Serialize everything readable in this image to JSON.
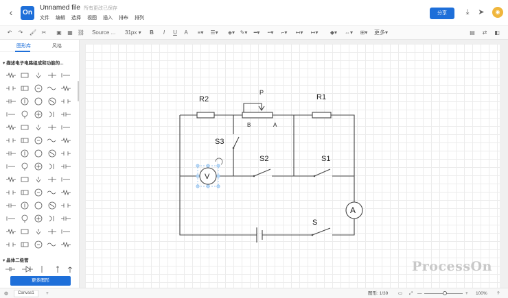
{
  "header": {
    "back_icon": "chevron-left-icon",
    "logo": "On",
    "title": "Unnamed file",
    "saved_status": "所有更改已保存",
    "menu": [
      "文件",
      "编辑",
      "选择",
      "视图",
      "插入",
      "排布",
      "排列"
    ],
    "share_label": "分享",
    "accent": "#1e6fd9"
  },
  "toolbar": {
    "font_name": "Source ...",
    "font_size": "31px",
    "bold": "B",
    "italic": "I",
    "underline": "U",
    "text_a": "A",
    "more": "更多"
  },
  "leftpanel": {
    "tabs": [
      "图形库",
      "风格"
    ],
    "section1": "描述电子电路组成和功能的...",
    "section2": "晶体二极管",
    "more_shapes": "更多图形"
  },
  "circuit": {
    "labels": {
      "r2": "R2",
      "r1": "R1",
      "p": "P",
      "b": "B",
      "a": "A",
      "s3": "S3",
      "s2": "S2",
      "s1": "S1",
      "s": "S",
      "voltmeter": "V",
      "ammeter": "A"
    }
  },
  "watermark": "ProcessOn",
  "statusbar": {
    "canvas_tab": "Canvas1",
    "add": "+",
    "shape_count": "图形: 1/39",
    "zoom_minus": "—",
    "zoom_plus": "+",
    "zoom": "100%"
  }
}
